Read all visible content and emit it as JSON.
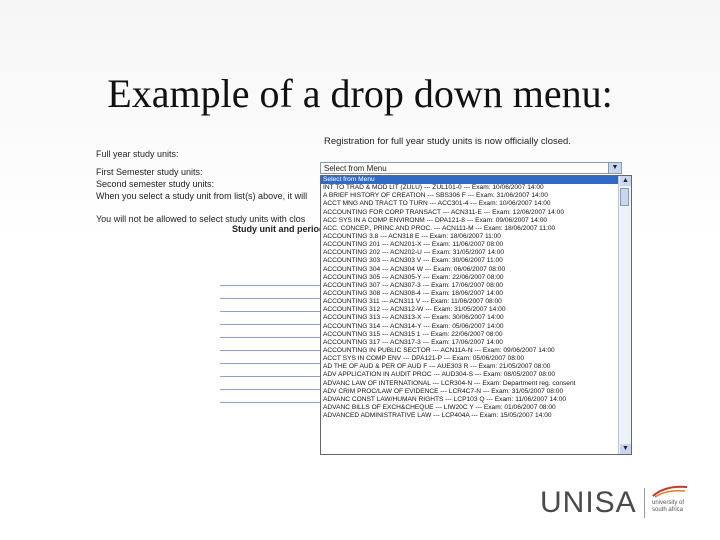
{
  "slide": {
    "title": "Example of a drop down menu:"
  },
  "form": {
    "notice": "Registration for full year study units is now officially closed.",
    "full_year_label": "Full year study units:",
    "first_semester_label": "First Semester study units:",
    "second_semester_label": "Second semester study units:",
    "instruction_label": "When you select a study unit from list(s) above, it will",
    "warning_label": "You will not be allowed to select study units with clos",
    "column_header": "Study unit and period"
  },
  "select": {
    "current_value": "Select from Menu",
    "options": [
      "Select from Menu",
      "INT TO TRAD & MOD LIT (ZULU) --- ZUL101-0 --- Exam: 10/06/2007 14:00",
      "A BRIEF HISTORY OF CREATION --- SBS306 F --- Exam: 31/06/2007 14:00",
      "ACCT MNG AND TRACT TO TURN --- ACC301-4 --- Exam: 10/06/2007 14:00",
      "ACCOUNTING FOR CORP TRANSACT --- ACN311-E --- Exam: 12/06/2007 14:00",
      "ACC SYS IN A COMP ENVIRONM --- DPA121-8 --- Exam: 09/06/2007 14:00",
      "ACC. CONCEP., PRINC AND PROC. --- ACN111-M --- Exam: 18/06/2007 11:00",
      "ACCOUNTING 3.8 --- ACN318 E --- Exam: 18/06/2007 11:00",
      "ACCOUNTING 201 --- ACN201-X --- Exam: 11/06/2007 08:00",
      "ACCOUNTING 202 --- ACN202-U --- Exam: 31/05/2007 14:00",
      "ACCOUNTING 303 --- ACN303 V --- Exam: 30/06/2007 11:00",
      "ACCOUNTING 304 --- ACN304 W --- Exam: 06/06/2007 08:00",
      "ACCOUNTING 305 --- ACN305-Y --- Exam: 22/06/2007 08:00",
      "ACCOUNTING 307 --- ACN307-3 --- Exam: 17/06/2007 08:00",
      "ACCOUNTING 308 --- ACN308-4 --- Exam: 18/06/2007 14:00",
      "ACCOUNTING 311 --- ACN311 V --- Exam: 11/06/2007 08:00",
      "ACCOUNTING 312 --- ACN312-W --- Exam: 31/05/2007 14:00",
      "ACCOUNTING 313 --- ACN313-X --- Exam: 30/06/2007 14:00",
      "ACCOUNTING 314 --- ACN314-Y --- Exam: 05/06/2007 14:00",
      "ACCOUNTING 315 --- ACN315 1 --- Exam: 22/06/2007 08:00",
      "ACCOUNTING 317 --- ACN317-3 --- Exam: 17/06/2007 14:00",
      "ACCOUNTING IN PUBLIC SECTOR --- ACN11A-N --- Exam: 09/06/2007 14:00",
      "ACCT SYS IN COMP ENV --- DPA121-P --- Exam: 05/06/2007 08:00",
      "AD THE OF AUD & PER OF AUD F --- AUE303 R --- Exam: 21/05/2007 08:00",
      "ADV APPLICATION IN AUDIT PROC --- AUD304-S --- Exam: 08/05/2007 08:00",
      "ADVANC LAW OF INTERNATIONAL --- LCR304-N --- Exam: Department reg. consent",
      "ADV CRIM PROC/LAW OF EVIDENCE --- LCR4C7-N --- Exam: 31/05/2007 08:00",
      "ADVANC CONST LAW/HUMAN RIGHTS --- LCP103 Q --- Exam: 11/06/2007 14:00",
      "ADVANC BILLS OF EXCH&CHEQUE --- LIW20C Y --- Exam: 01/06/2007 08:00",
      "ADVANCED ADMINISTRATIVE LAW --- LCP404A --- Exam: 15/05/2007 14:00"
    ]
  },
  "logo": {
    "name": "UNISA",
    "subtitle": "university of south africa"
  },
  "colors": {
    "selection": "#316ac5",
    "accent": "#c0392b"
  }
}
